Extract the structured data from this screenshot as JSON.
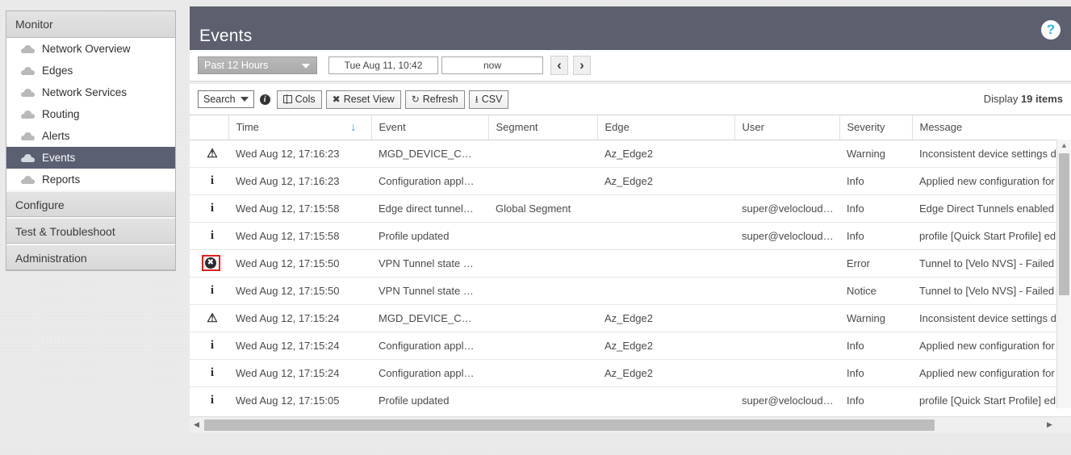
{
  "sidebar": {
    "groups": [
      {
        "label": "Monitor",
        "items": [
          {
            "label": "Network Overview",
            "active": false
          },
          {
            "label": "Edges",
            "active": false
          },
          {
            "label": "Network Services",
            "active": false
          },
          {
            "label": "Routing",
            "active": false
          },
          {
            "label": "Alerts",
            "active": false
          },
          {
            "label": "Events",
            "active": true
          },
          {
            "label": "Reports",
            "active": false
          }
        ]
      },
      {
        "label": "Configure",
        "items": []
      },
      {
        "label": "Test & Troubleshoot",
        "items": []
      },
      {
        "label": "Administration",
        "items": []
      }
    ]
  },
  "header": {
    "title": "Events",
    "help_icon": "question-mark-icon",
    "help_label": "?"
  },
  "timebar": {
    "range_label": "Past 12 Hours",
    "from_value": "Tue Aug 11, 10:42",
    "to_value": "now",
    "prev_label": "‹",
    "next_label": "›"
  },
  "toolbar": {
    "search_label": "Search",
    "info_label": "i",
    "cols_label": "Cols",
    "reset_view_label": "Reset View",
    "reset_view_icon": "✖",
    "refresh_label": "Refresh",
    "refresh_icon": "↻",
    "csv_label": "CSV",
    "csv_icon": "⭳",
    "display_prefix": "Display",
    "display_count": "19 items"
  },
  "table": {
    "columns": [
      {
        "key": "icon",
        "label": ""
      },
      {
        "key": "time",
        "label": "Time",
        "sorted": true,
        "sort_arrow": "↓"
      },
      {
        "key": "event",
        "label": "Event"
      },
      {
        "key": "segment",
        "label": "Segment"
      },
      {
        "key": "edge",
        "label": "Edge"
      },
      {
        "key": "user",
        "label": "User"
      },
      {
        "key": "severity",
        "label": "Severity"
      },
      {
        "key": "message",
        "label": "Message"
      }
    ],
    "rows": [
      {
        "icon": "warning-icon",
        "icon_glyph": "⚠",
        "highlighted": false,
        "time": "Wed Aug 12, 17:16:23",
        "event": "MGD_DEVICE_C…",
        "segment": "",
        "edge": "Az_Edge2",
        "user": "",
        "severity": "Warning",
        "message": "Inconsistent device settings d"
      },
      {
        "icon": "info-icon",
        "icon_glyph": "i",
        "highlighted": false,
        "time": "Wed Aug 12, 17:16:23",
        "event": "Configuration appl…",
        "segment": "",
        "edge": "Az_Edge2",
        "user": "",
        "severity": "Info",
        "message": "Applied new configuration for"
      },
      {
        "icon": "info-icon",
        "icon_glyph": "i",
        "highlighted": false,
        "time": "Wed Aug 12, 17:15:58",
        "event": "Edge direct tunnel…",
        "segment": "Global Segment",
        "edge": "",
        "user": "super@velocloud…",
        "severity": "Info",
        "message": "Edge Direct Tunnels enabled"
      },
      {
        "icon": "info-icon",
        "icon_glyph": "i",
        "highlighted": false,
        "time": "Wed Aug 12, 17:15:58",
        "event": "Profile updated",
        "segment": "",
        "edge": "",
        "user": "super@velocloud…",
        "severity": "Info",
        "message": "profile [Quick Start Profile] edi"
      },
      {
        "icon": "error-icon",
        "icon_glyph": "✖",
        "highlighted": true,
        "time": "Wed Aug 12, 17:15:50",
        "event": "VPN Tunnel state …",
        "segment": "",
        "edge": "",
        "user": "",
        "severity": "Error",
        "message": "Tunnel to [Velo NVS] - Failed"
      },
      {
        "icon": "info-icon",
        "icon_glyph": "i",
        "highlighted": false,
        "time": "Wed Aug 12, 17:15:50",
        "event": "VPN Tunnel state …",
        "segment": "",
        "edge": "",
        "user": "",
        "severity": "Notice",
        "message": "Tunnel to [Velo NVS] - Failed"
      },
      {
        "icon": "warning-icon",
        "icon_glyph": "⚠",
        "highlighted": false,
        "time": "Wed Aug 12, 17:15:24",
        "event": "MGD_DEVICE_C…",
        "segment": "",
        "edge": "Az_Edge2",
        "user": "",
        "severity": "Warning",
        "message": "Inconsistent device settings d"
      },
      {
        "icon": "info-icon",
        "icon_glyph": "i",
        "highlighted": false,
        "time": "Wed Aug 12, 17:15:24",
        "event": "Configuration appl…",
        "segment": "",
        "edge": "Az_Edge2",
        "user": "",
        "severity": "Info",
        "message": "Applied new configuration for"
      },
      {
        "icon": "info-icon",
        "icon_glyph": "i",
        "highlighted": false,
        "time": "Wed Aug 12, 17:15:24",
        "event": "Configuration appl…",
        "segment": "",
        "edge": "Az_Edge2",
        "user": "",
        "severity": "Info",
        "message": "Applied new configuration for"
      },
      {
        "icon": "info-icon",
        "icon_glyph": "i",
        "highlighted": false,
        "time": "Wed Aug 12, 17:15:05",
        "event": "Profile updated",
        "segment": "",
        "edge": "",
        "user": "super@velocloud…",
        "severity": "Info",
        "message": "profile [Quick Start Profile] edi"
      }
    ]
  },
  "scroll": {
    "v_up": "▲",
    "v_down": "▼",
    "h_left": "◀",
    "h_right": "▶"
  },
  "colors": {
    "header_bg": "#5b5f6e",
    "active_nav": "#5b5f72",
    "link": "#2e9ccc",
    "help_accent": "#29b6e8",
    "error_highlight": "#e02020",
    "sort_arrow": "#3aa4d6"
  }
}
